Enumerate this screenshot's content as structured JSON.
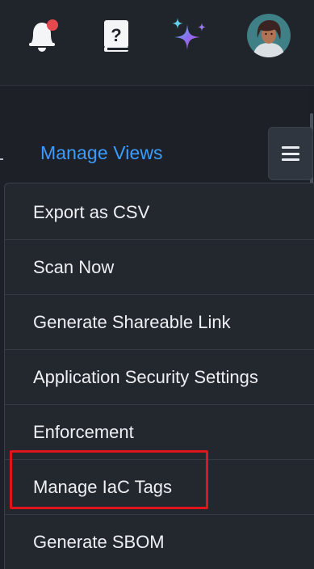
{
  "header": {
    "icons": [
      "bell-icon",
      "help-book-icon",
      "sparkle-icon",
      "avatar"
    ],
    "notification_dot_color": "#e5484d",
    "help_glyph": "?"
  },
  "toolbar": {
    "manage_views_label": "Manage Views",
    "menu_toggle_icon": "hamburger-icon"
  },
  "menu": {
    "items": [
      {
        "label": "Export as CSV"
      },
      {
        "label": "Scan Now"
      },
      {
        "label": "Generate Shareable Link"
      },
      {
        "label": "Application Security Settings"
      },
      {
        "label": "Enforcement"
      },
      {
        "label": "Manage IaC Tags"
      },
      {
        "label": "Generate SBOM"
      }
    ]
  },
  "colors": {
    "accent_link": "#3b9cff",
    "highlight": "#e0141b",
    "background": "#1f2329"
  }
}
